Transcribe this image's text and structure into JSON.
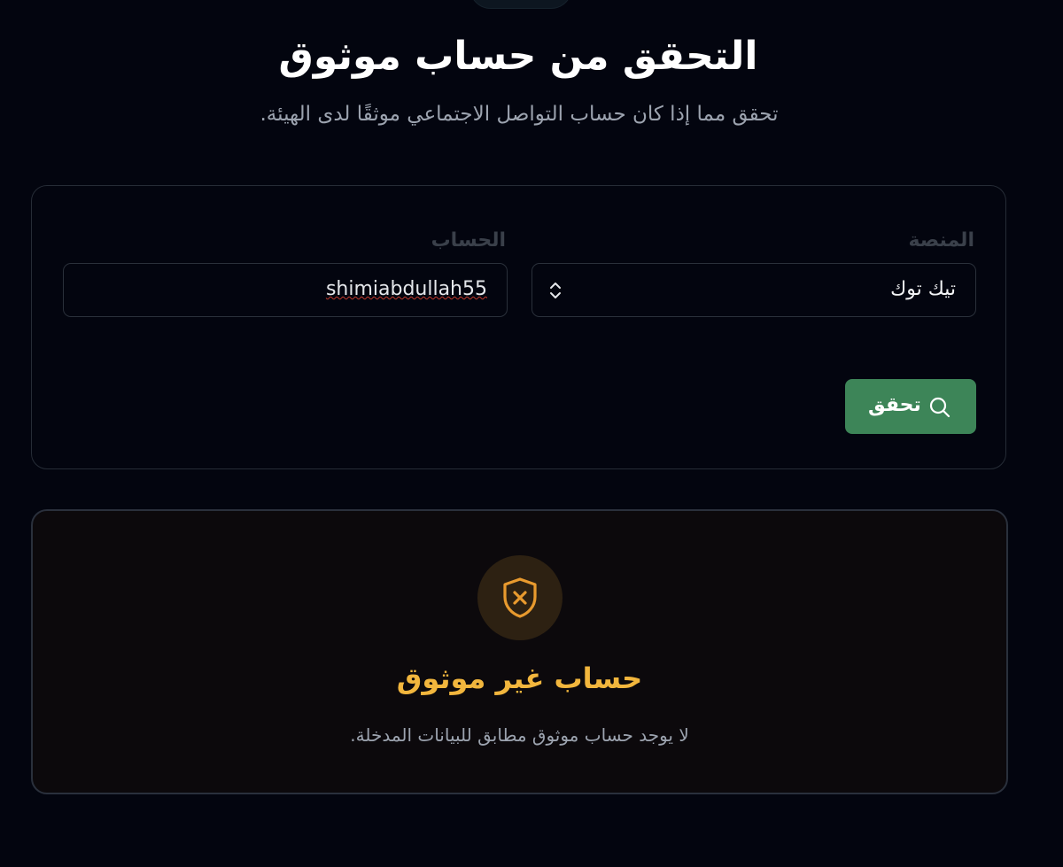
{
  "header": {
    "title": "التحقق من حساب موثوق",
    "subtitle": "تحقق مما إذا كان حساب التواصل الاجتماعي موثقًا لدى الهيئة."
  },
  "form": {
    "platform_label": "المنصة",
    "platform_value": "تيك توك",
    "account_label": "الحساب",
    "account_value": "shimiabdullah55",
    "verify_button_label": "تحقق",
    "accent_color": "#3d8558"
  },
  "result": {
    "status_icon": "shield-x-icon",
    "title": "حساب غير موثوق",
    "message": "لا يوجد حساب موثوق مطابق للبيانات المدخلة.",
    "status_color": "#f2b63d"
  }
}
